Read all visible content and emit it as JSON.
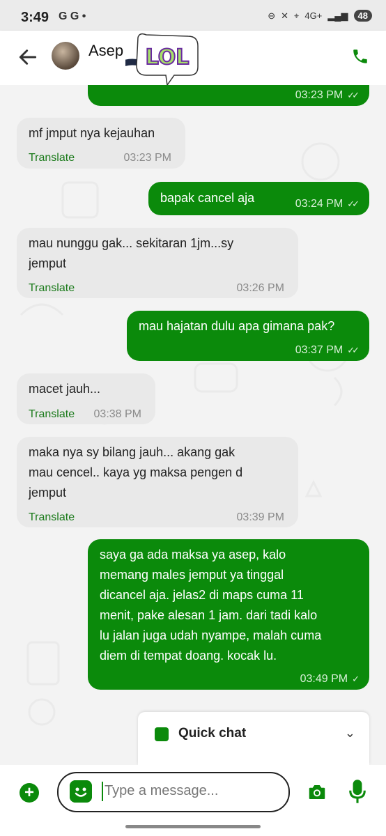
{
  "status_bar": {
    "time": "3:49",
    "left_icons": "G G •",
    "network": "4G+",
    "battery": "48"
  },
  "header": {
    "contact_name": "Asep",
    "sticker_text": "LOL"
  },
  "messages": [
    {
      "dir": "out",
      "text": "",
      "time": "03:23 PM"
    },
    {
      "dir": "in",
      "text": "mf jmput nya kejauhan",
      "translate": "Translate",
      "time": "03:23 PM"
    },
    {
      "dir": "out",
      "text": "bapak cancel aja",
      "time": "03:24 PM"
    },
    {
      "dir": "in",
      "text": "mau nunggu gak... sekitaran 1jm...sy\njemput",
      "translate": "Translate",
      "time": "03:26 PM"
    },
    {
      "dir": "out",
      "text": "mau hajatan dulu apa gimana pak?",
      "time": "03:37 PM"
    },
    {
      "dir": "in",
      "text": "macet jauh...",
      "translate": "Translate",
      "time": "03:38 PM"
    },
    {
      "dir": "in",
      "text": "maka nya sy bilang jauh... akang gak\nmau cencel.. kaya yg maksa pengen d\njemput",
      "translate": "Translate",
      "time": "03:39 PM"
    },
    {
      "dir": "out",
      "text": "saya ga ada maksa ya asep, kalo\nmemang males jemput ya tinggal\ndicancel aja. jelas2 di maps cuma 11\nmenit, pake alesan 1 jam. dari tadi kalo\nlu jalan juga udah nyampe, malah cuma\ndiem di tempat doang. kocak lu.",
      "time": "03:49 PM"
    }
  ],
  "quick_chat": {
    "label": "Quick chat"
  },
  "input": {
    "placeholder": "Type a message..."
  },
  "colors": {
    "accent": "#0b8a0b",
    "incoming_bubble": "#e9e9e9"
  }
}
